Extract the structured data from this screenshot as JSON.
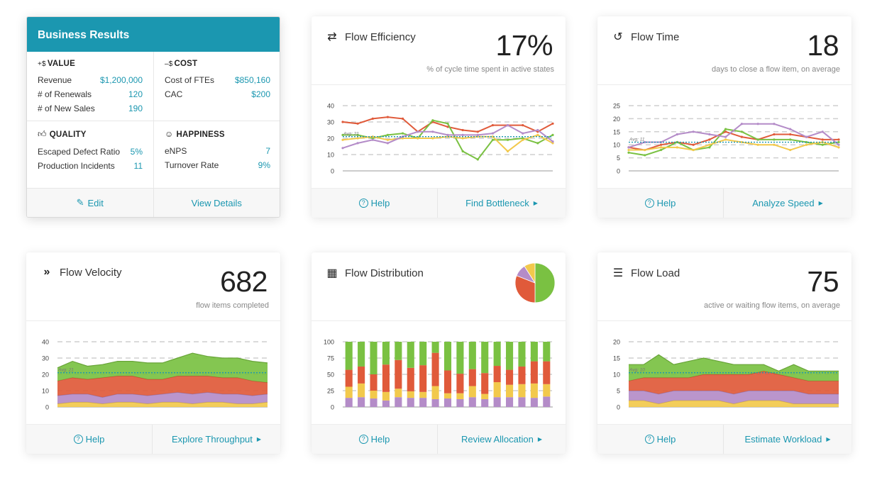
{
  "business_results": {
    "title": "Business Results",
    "value": {
      "prefix": "+$",
      "title": "VALUE",
      "rows": [
        {
          "label": "Revenue",
          "value": "$1,200,000"
        },
        {
          "label": "# of Renewals",
          "value": "120"
        },
        {
          "label": "# of New Sales",
          "value": "190"
        }
      ]
    },
    "cost": {
      "prefix": "–$",
      "title": "COST",
      "rows": [
        {
          "label": "Cost of FTEs",
          "value": "$850,160"
        },
        {
          "label": "CAC",
          "value": "$200"
        }
      ]
    },
    "quality": {
      "icon": "thumbs-up-icon",
      "title": "QUALITY",
      "rows": [
        {
          "label": "Escaped Defect Ratio",
          "value": "5%"
        },
        {
          "label": "Production Incidents",
          "value": "11"
        }
      ]
    },
    "happiness": {
      "icon": "smiley-icon",
      "title": "HAPPINESS",
      "rows": [
        {
          "label": "eNPS",
          "value": "7"
        },
        {
          "label": "Turnover Rate",
          "value": "9%"
        }
      ]
    },
    "edit_label": "Edit",
    "details_label": "View Details"
  },
  "cards": {
    "efficiency": {
      "title": "Flow Efficiency",
      "value": "17%",
      "subtitle": "% of cycle time spent in active states",
      "help": "Help",
      "action": "Find Bottleneck"
    },
    "time": {
      "title": "Flow Time",
      "value": "18",
      "subtitle": "days to close a flow item, on average",
      "help": "Help",
      "action": "Analyze Speed"
    },
    "velocity": {
      "title": "Flow Velocity",
      "value": "682",
      "subtitle": "flow items completed",
      "help": "Help",
      "action": "Explore Throughput"
    },
    "distribution": {
      "title": "Flow Distribution",
      "help": "Help",
      "action": "Review Allocation"
    },
    "load": {
      "title": "Flow Load",
      "value": "75",
      "subtitle": "active or waiting flow items, on average",
      "help": "Help",
      "action": "Estimate Workload"
    }
  },
  "colors": {
    "accent": "#1b97b0",
    "green": "#7ac142",
    "red": "#e05a3a",
    "yellow": "#f2c94c",
    "purple": "#b48cc8",
    "grid": "#cccccc",
    "avg": "#1b97b0"
  },
  "chart_data": [
    {
      "id": "efficiency",
      "type": "line",
      "ylim": [
        0,
        40
      ],
      "yticks": [
        0,
        10,
        20,
        30,
        40
      ],
      "avg": 21,
      "avg_label": "Avg: 21",
      "series": [
        {
          "color": "red",
          "values": [
            30,
            29,
            32,
            33,
            32,
            24,
            30,
            27,
            25,
            24,
            28,
            28,
            28,
            24,
            29
          ]
        },
        {
          "color": "green",
          "values": [
            22,
            22,
            20,
            22,
            23,
            20,
            31,
            29,
            12,
            7,
            19,
            19,
            20,
            17,
            22
          ]
        },
        {
          "color": "yellow",
          "values": [
            19,
            20,
            21,
            19,
            20,
            20,
            20,
            21,
            20,
            21,
            21,
            12,
            19,
            22,
            17
          ]
        },
        {
          "color": "purple",
          "values": [
            14,
            17,
            19,
            17,
            21,
            24,
            24,
            22,
            22,
            22,
            23,
            28,
            23,
            25,
            18
          ]
        }
      ]
    },
    {
      "id": "time",
      "type": "line",
      "ylim": [
        0,
        25
      ],
      "yticks": [
        0,
        5,
        10,
        15,
        20,
        25
      ],
      "avg": 11,
      "avg_label": "Avg: 11",
      "series": [
        {
          "color": "red",
          "values": [
            9,
            8,
            10,
            11,
            10,
            12,
            15,
            13,
            12,
            14,
            14,
            13,
            12,
            12
          ]
        },
        {
          "color": "green",
          "values": [
            7,
            6,
            8,
            11,
            8,
            9,
            16,
            15,
            12,
            12,
            12,
            11,
            10,
            11
          ]
        },
        {
          "color": "yellow",
          "values": [
            8,
            8,
            9,
            9,
            8,
            10,
            12,
            11,
            10,
            10,
            8,
            10,
            11,
            9
          ]
        },
        {
          "color": "purple",
          "values": [
            9,
            11,
            11,
            14,
            15,
            14,
            13,
            18,
            18,
            18,
            16,
            13,
            15,
            10
          ]
        }
      ]
    },
    {
      "id": "velocity",
      "type": "area",
      "ylim": [
        0,
        40
      ],
      "yticks": [
        0,
        10,
        20,
        30,
        40
      ],
      "avg": 21,
      "avg_label": "Avg: 21",
      "series": [
        {
          "color": "yellow",
          "values": [
            2,
            3,
            3,
            2,
            3,
            3,
            2,
            3,
            3,
            2,
            3,
            3,
            2,
            2,
            3
          ]
        },
        {
          "color": "purple",
          "values": [
            5,
            5,
            5,
            4,
            5,
            5,
            5,
            5,
            6,
            6,
            6,
            5,
            6,
            5,
            5
          ]
        },
        {
          "color": "red",
          "values": [
            9,
            10,
            9,
            12,
            11,
            11,
            10,
            9,
            10,
            11,
            10,
            10,
            10,
            9,
            7
          ]
        },
        {
          "color": "green",
          "values": [
            8,
            10,
            8,
            8,
            9,
            9,
            10,
            10,
            11,
            14,
            12,
            12,
            12,
            12,
            12
          ]
        }
      ]
    },
    {
      "id": "distribution",
      "type": "bar",
      "ylim": [
        0,
        100
      ],
      "yticks": [
        0,
        25,
        50,
        75,
        100
      ],
      "stacked_percent": true,
      "series": [
        {
          "color": "purple",
          "values": [
            14,
            15,
            13,
            10,
            15,
            14,
            14,
            12,
            13,
            12,
            15,
            12,
            15,
            15,
            15,
            14,
            16
          ]
        },
        {
          "color": "yellow",
          "values": [
            17,
            21,
            12,
            13,
            13,
            10,
            9,
            20,
            8,
            9,
            17,
            8,
            23,
            19,
            20,
            22,
            19
          ]
        },
        {
          "color": "red",
          "values": [
            26,
            26,
            25,
            42,
            44,
            36,
            41,
            51,
            35,
            30,
            26,
            32,
            25,
            23,
            27,
            34,
            35
          ]
        },
        {
          "color": "green",
          "values": [
            43,
            38,
            50,
            35,
            28,
            40,
            36,
            17,
            44,
            49,
            42,
            48,
            37,
            43,
            38,
            30,
            30
          ]
        }
      ],
      "pie": [
        {
          "color": "green",
          "value": 50
        },
        {
          "color": "red",
          "value": 31
        },
        {
          "color": "purple",
          "value": 10
        },
        {
          "color": "yellow",
          "value": 9
        }
      ]
    },
    {
      "id": "load",
      "type": "area",
      "ylim": [
        0,
        20
      ],
      "yticks": [
        0,
        5,
        10,
        15,
        20
      ],
      "avg": 10.5,
      "avg_label": "Avg: 10",
      "series": [
        {
          "color": "yellow",
          "values": [
            2,
            2,
            1,
            2,
            2,
            2,
            2,
            1,
            2,
            2,
            2,
            1,
            1,
            1,
            1
          ]
        },
        {
          "color": "purple",
          "values": [
            3,
            3,
            3,
            3,
            3,
            3,
            3,
            3,
            3,
            3,
            3,
            4,
            3,
            3,
            3
          ]
        },
        {
          "color": "red",
          "values": [
            3,
            4,
            5,
            4,
            4,
            5,
            5,
            6,
            5,
            6,
            5,
            4,
            4,
            4,
            4
          ]
        },
        {
          "color": "green",
          "values": [
            5,
            4,
            7,
            4,
            5,
            5,
            4,
            3,
            3,
            2,
            1,
            4,
            3,
            3,
            3
          ]
        }
      ]
    }
  ]
}
